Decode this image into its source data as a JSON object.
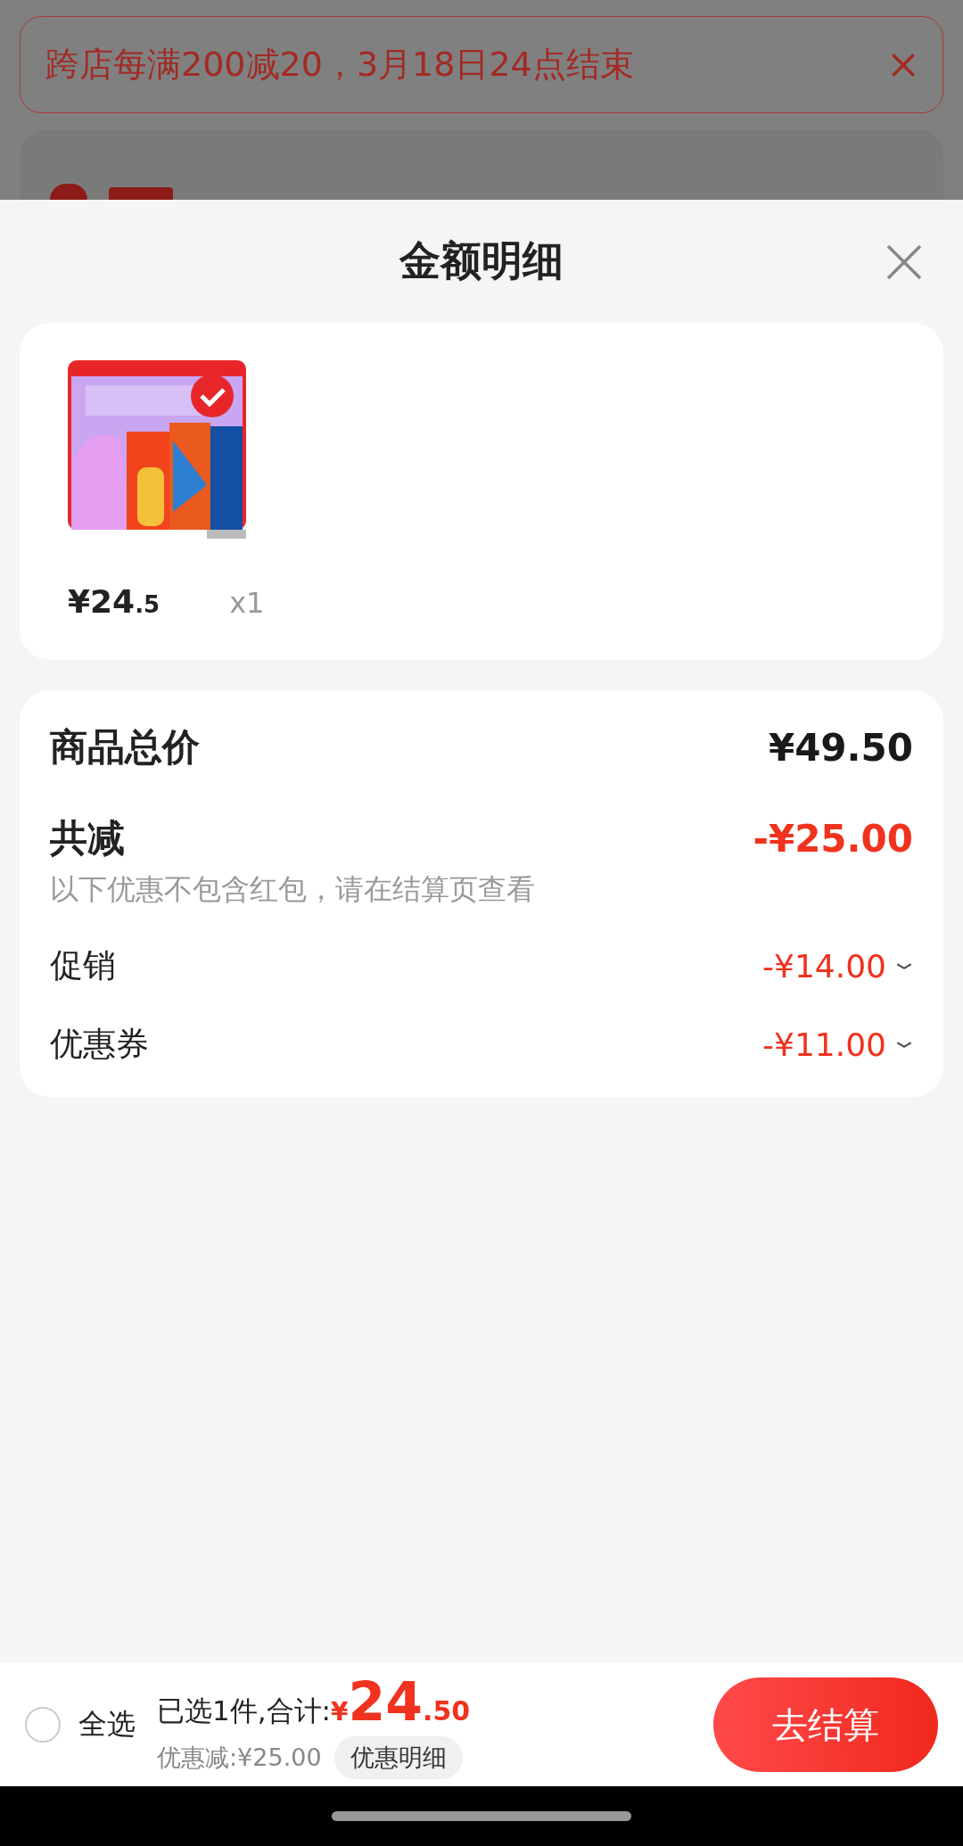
{
  "promo_banner": {
    "text": "跨店每满200减20，3月18日24点结束"
  },
  "sheet": {
    "title": "金额明细"
  },
  "product": {
    "price_main": "¥24",
    "price_decimal": ".5",
    "quantity": "x1"
  },
  "summary": {
    "total": {
      "label": "商品总价",
      "value": "¥49.50"
    },
    "discount": {
      "label": "共减",
      "value": "-¥25.00",
      "note": "以下优惠不包含红包，请在结算页查看"
    },
    "items": [
      {
        "label": "促销",
        "value": "-¥14.00",
        "expanded": false
      },
      {
        "label": "优惠券",
        "value": "-¥11.00",
        "expanded": false
      }
    ]
  },
  "bottom_bar": {
    "select_all": {
      "label": "全选",
      "checked": false
    },
    "selected_text": "已选1件,合计:",
    "currency": "¥",
    "total_main": "24",
    "total_decimal": ".50",
    "saved": "优惠减:¥25.00",
    "details_button": "优惠明细",
    "checkout_button": "去结算"
  }
}
